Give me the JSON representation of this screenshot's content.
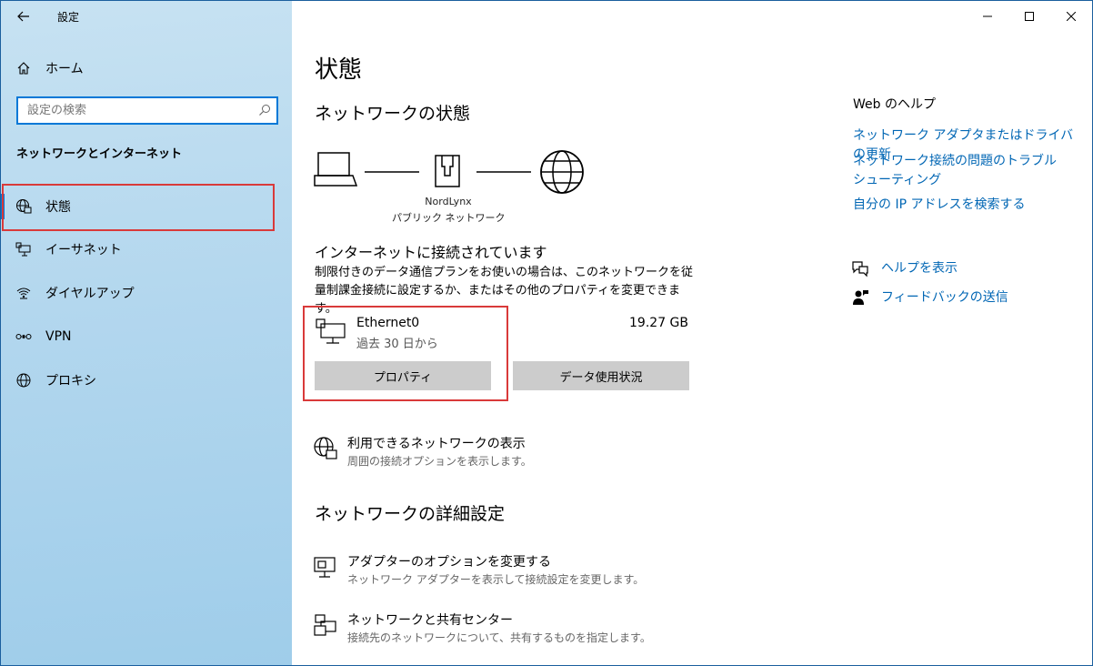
{
  "window": {
    "app_title": "設定",
    "back_icon": "back-arrow-icon",
    "controls": [
      "minimize-icon",
      "maximize-icon",
      "close-icon"
    ]
  },
  "sidebar": {
    "home_label": "ホーム",
    "search_placeholder": "設定の検索",
    "section_title": "ネットワークとインターネット",
    "items": [
      {
        "label": "状態",
        "icon": "globe-network-icon",
        "active": true
      },
      {
        "label": "イーサネット",
        "icon": "ethernet-icon"
      },
      {
        "label": "ダイヤルアップ",
        "icon": "dialup-icon"
      },
      {
        "label": "VPN",
        "icon": "vpn-icon"
      },
      {
        "label": "プロキシ",
        "icon": "proxy-globe-icon"
      }
    ]
  },
  "main": {
    "page_title": "状態",
    "network_status_heading": "ネットワークの状態",
    "diagram": {
      "network_name": "NordLynx",
      "network_type": "パブリック ネットワーク"
    },
    "connection_title": "インターネットに接続されています",
    "connection_desc": "制限付きのデータ通信プランをお使いの場合は、このネットワークを従量制課金接続に設定するか、またはその他のプロパティを変更できます。",
    "adapter": {
      "name": "Ethernet0",
      "period": "過去 30 日から",
      "usage": "19.27 GB",
      "properties_button": "プロパティ",
      "data_usage_button": "データ使用状況"
    },
    "show_networks": {
      "title": "利用できるネットワークの表示",
      "desc": "周囲の接続オプションを表示します。"
    },
    "advanced_heading": "ネットワークの詳細設定",
    "adapter_options": {
      "title": "アダプターのオプションを変更する",
      "desc": "ネットワーク アダプターを表示して接続設定を変更します。"
    },
    "sharing_center": {
      "title": "ネットワークと共有センター",
      "desc": "接続先のネットワークについて、共有するものを指定します。"
    }
  },
  "help_panel": {
    "title": "Web のヘルプ",
    "links": [
      "ネットワーク アダプタまたはドライバの更新",
      "ネットワーク接続の問題のトラブルシューティング",
      "自分の IP アドレスを検索する"
    ],
    "get_help": "ヘルプを表示",
    "feedback": "フィードバックの送信"
  },
  "colors": {
    "accent": "#0078d7",
    "link": "#0066b4",
    "highlight_box": "#d93a3a"
  }
}
